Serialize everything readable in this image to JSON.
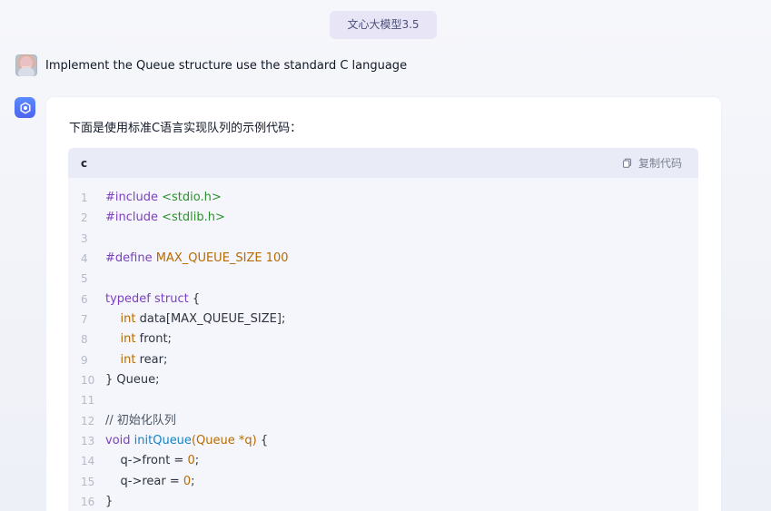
{
  "header": {
    "model_badge": "文心大模型3.5"
  },
  "user_message": {
    "text": "Implement the Queue structure use the standard C language"
  },
  "assistant_message": {
    "intro": "下面是使用标准C语言实现队列的示例代码：",
    "code_block": {
      "language": "c",
      "copy_label": "复制代码",
      "lines": [
        {
          "number": "1",
          "parts": [
            {
              "text": "#include ",
              "cls": "kw"
            },
            {
              "text": "<stdio.h>",
              "cls": "str"
            }
          ]
        },
        {
          "number": "2",
          "parts": [
            {
              "text": "#include ",
              "cls": "kw"
            },
            {
              "text": "<stdlib.h>",
              "cls": "str"
            }
          ]
        },
        {
          "number": "3",
          "parts": []
        },
        {
          "number": "4",
          "parts": [
            {
              "text": "#define ",
              "cls": "kw"
            },
            {
              "text": "MAX_QUEUE_SIZE 100",
              "cls": "type"
            }
          ]
        },
        {
          "number": "5",
          "parts": []
        },
        {
          "number": "6",
          "parts": [
            {
              "text": "typedef ",
              "cls": "kw"
            },
            {
              "text": "struct",
              "cls": "kw"
            },
            {
              "text": " {",
              "cls": ""
            }
          ]
        },
        {
          "number": "7",
          "parts": [
            {
              "text": "    ",
              "cls": ""
            },
            {
              "text": "int",
              "cls": "type"
            },
            {
              "text": " data[MAX_QUEUE_SIZE];",
              "cls": ""
            }
          ]
        },
        {
          "number": "8",
          "parts": [
            {
              "text": "    ",
              "cls": ""
            },
            {
              "text": "int",
              "cls": "type"
            },
            {
              "text": " front;",
              "cls": ""
            }
          ]
        },
        {
          "number": "9",
          "parts": [
            {
              "text": "    ",
              "cls": ""
            },
            {
              "text": "int",
              "cls": "type"
            },
            {
              "text": " rear;",
              "cls": ""
            }
          ]
        },
        {
          "number": "10",
          "parts": [
            {
              "text": "} Queue;",
              "cls": ""
            }
          ]
        },
        {
          "number": "11",
          "parts": []
        },
        {
          "number": "12",
          "parts": [
            {
              "text": "// 初始化队列",
              "cls": "cm"
            }
          ]
        },
        {
          "number": "13",
          "parts": [
            {
              "text": "void ",
              "cls": "kw"
            },
            {
              "text": "initQueue",
              "cls": "fn"
            },
            {
              "text": "(Queue *q)",
              "cls": "type"
            },
            {
              "text": " {",
              "cls": ""
            }
          ]
        },
        {
          "number": "14",
          "parts": [
            {
              "text": "    q->front = ",
              "cls": ""
            },
            {
              "text": "0",
              "cls": "num"
            },
            {
              "text": ";",
              "cls": ""
            }
          ]
        },
        {
          "number": "15",
          "parts": [
            {
              "text": "    q->rear = ",
              "cls": ""
            },
            {
              "text": "0",
              "cls": "num"
            },
            {
              "text": ";",
              "cls": ""
            }
          ]
        },
        {
          "number": "16",
          "parts": [
            {
              "text": "}",
              "cls": ""
            }
          ]
        }
      ]
    }
  }
}
